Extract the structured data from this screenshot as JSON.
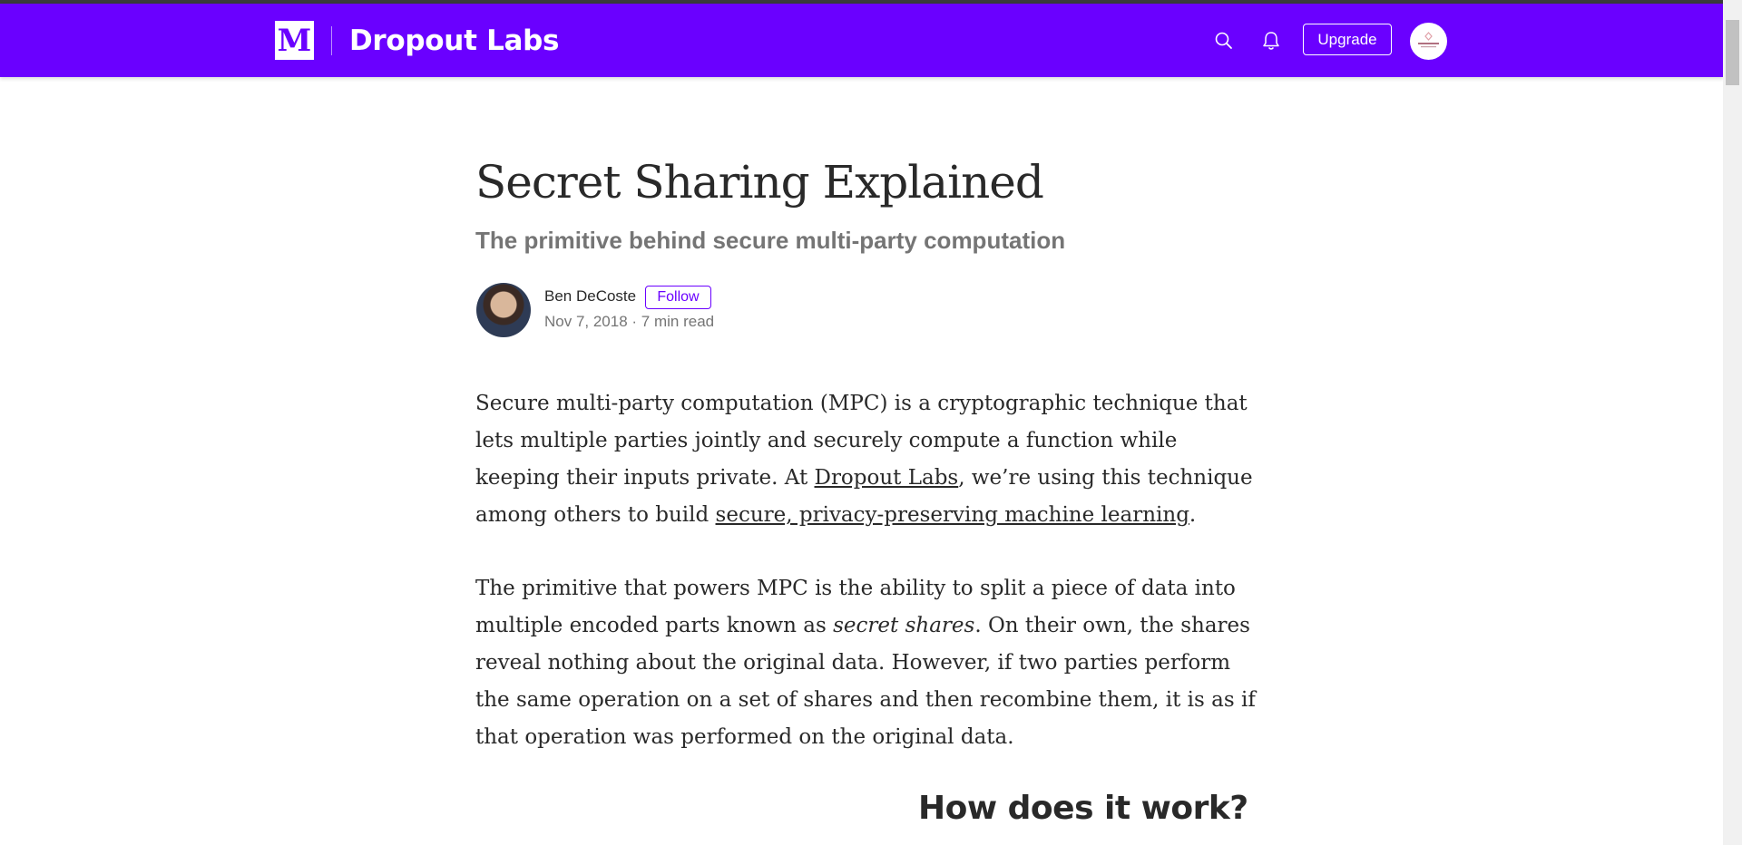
{
  "header": {
    "logo_letter": "M",
    "publication": "Dropout Labs",
    "upgrade_label": "Upgrade",
    "background": "#6a00ff"
  },
  "article": {
    "title": "Secret Sharing Explained",
    "subtitle": "The primitive behind secure multi-party computation",
    "author": "Ben DeCoste",
    "follow_label": "Follow",
    "meta": "Nov 7, 2018 · 7 min read",
    "p1": {
      "t1": "Secure multi-party computation (MPC) is a cryptographic technique that lets multiple parties jointly and securely compute a function while keeping their inputs private. At ",
      "link1": "Dropout Labs",
      "t2": ", we’re using this technique among others to build ",
      "link2": "secure, privacy-preserving machine learning",
      "t3": "."
    },
    "p2": {
      "t1": "The primitive that powers MPC is the ability to split a piece of data into multiple encoded parts known as ",
      "em": "secret shares",
      "t2": ". On their own, the shares reveal nothing about the original data. However, if two parties perform the same operation on a set of shares and then recombine them, it is as if that operation was performed on the original data."
    },
    "section_heading": "How does it work?"
  },
  "icons": {
    "search": "search-icon",
    "bell": "bell-icon",
    "avatar": "user-avatar"
  }
}
